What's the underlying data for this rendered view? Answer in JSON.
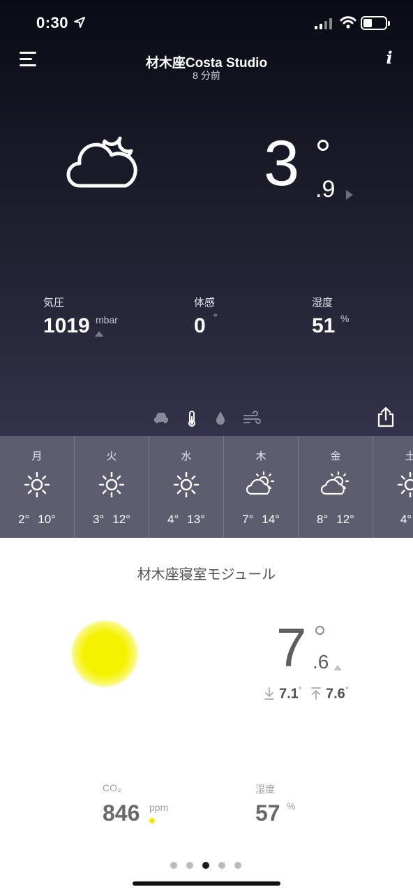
{
  "status_bar": {
    "time": "0:30"
  },
  "header": {
    "station_name": "材木座Costa Studio",
    "updated": "8 分前"
  },
  "outdoor": {
    "condition_icon": "cloud-moon-icon",
    "temp_int": "3",
    "temp_dec": ".9",
    "stats": [
      {
        "label": "気圧",
        "value": "1019",
        "unit": "mbar"
      },
      {
        "label": "体感",
        "value": "0",
        "unit": "°"
      },
      {
        "label": "湿度",
        "value": "51",
        "unit": "%"
      }
    ]
  },
  "toolbar_icons": [
    "car-icon",
    "thermometer-icon",
    "rain-drop-icon",
    "wind-icon",
    "share-icon"
  ],
  "forecast": [
    {
      "day": "月",
      "icon": "sun-icon",
      "low": "2°",
      "high": "10°"
    },
    {
      "day": "火",
      "icon": "sun-icon",
      "low": "3°",
      "high": "12°"
    },
    {
      "day": "水",
      "icon": "sun-icon",
      "low": "4°",
      "high": "13°"
    },
    {
      "day": "木",
      "icon": "partly-cloudy-icon",
      "low": "7°",
      "high": "14°"
    },
    {
      "day": "金",
      "icon": "partly-cloudy-icon",
      "low": "8°",
      "high": "12°"
    },
    {
      "day": "土",
      "icon": "sun-icon",
      "low": "4°",
      "high": ""
    }
  ],
  "indoor": {
    "module_name": "材木座寝室モジュール",
    "temp_int": "7",
    "temp_dec": ".6",
    "min": "7.1",
    "max": "7.6",
    "min_deg": "°",
    "max_deg": "°",
    "co2_label": "CO₂",
    "co2_value": "846",
    "co2_unit": "ppm",
    "hum_label": "湿度",
    "hum_value": "57",
    "hum_unit": "%",
    "air_quality_color": "#f5f200"
  },
  "pagination": {
    "count": 5,
    "active_index": 2
  },
  "colors": {
    "top_bg": "#1c1c2b",
    "forecast_bg": "#5e5d70",
    "accent_yellow": "#f5f200"
  }
}
